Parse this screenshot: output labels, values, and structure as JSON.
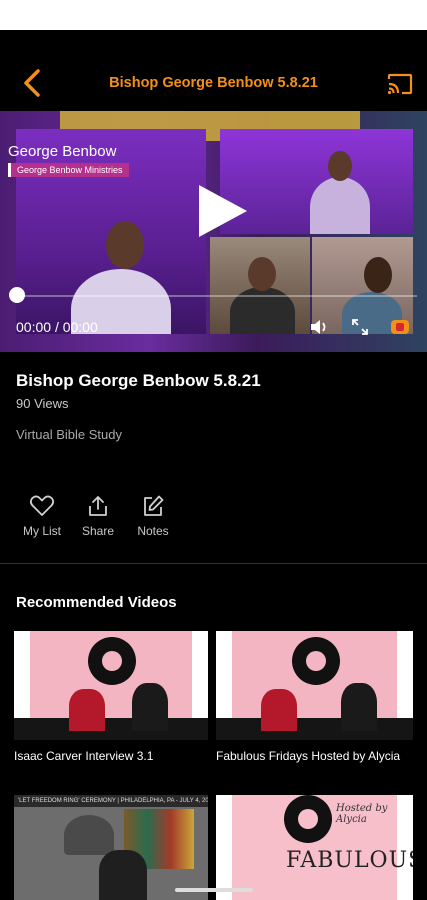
{
  "header": {
    "title": "Bishop George Benbow 5.8.21",
    "back_icon": "back-chevron-icon",
    "cast_icon": "cast-icon",
    "accent_color": "#f39019"
  },
  "player": {
    "overlay_name": "George Benbow",
    "overlay_org": "George Benbow Ministries",
    "current_time": "00:00",
    "separator": "/",
    "duration": "00:00",
    "progress": 0
  },
  "video": {
    "title": "Bishop George Benbow 5.8.21",
    "views": "90 Views",
    "category": "Virtual Bible Study"
  },
  "actions": [
    {
      "label": "My List",
      "icon": "heart-icon"
    },
    {
      "label": "Share",
      "icon": "share-icon"
    },
    {
      "label": "Notes",
      "icon": "edit-icon"
    }
  ],
  "recommended": {
    "title": "Recommended Videos",
    "items": [
      {
        "title": "Isaac Carver Interview 3.1"
      },
      {
        "title": "Fabulous Fridays Hosted by Alycia"
      },
      {
        "title": "",
        "banner": "'LET FREEDOM RING' CEREMONY | PHILADELPHIA, PA - JULY 4, 2020"
      },
      {
        "title": "",
        "thumb_text": "FABULOUS",
        "hosted_text": "Hosted by Alycia"
      }
    ]
  }
}
